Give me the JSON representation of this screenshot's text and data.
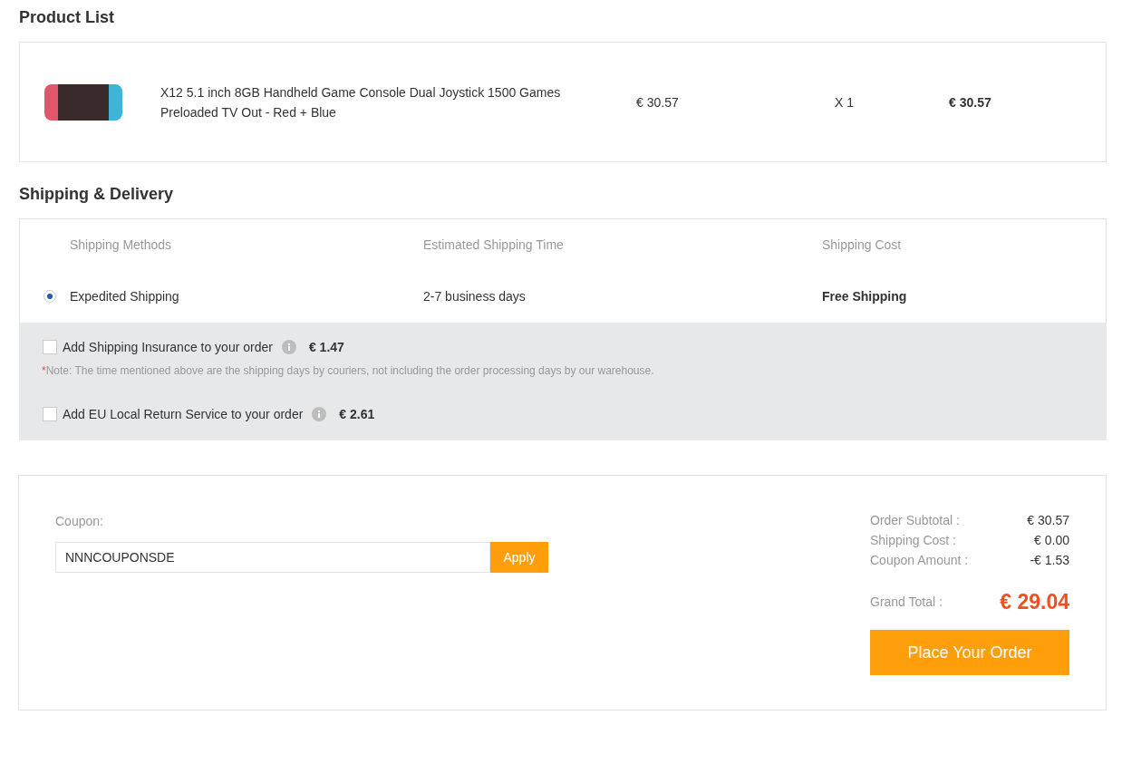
{
  "product_list": {
    "title": "Product List",
    "items": [
      {
        "name": "X12 5.1 inch 8GB Handheld Game Console Dual Joystick 1500 Games Preloaded TV Out - Red + Blue",
        "price": "€ 30.57",
        "quantity": "X 1",
        "total": "€ 30.57"
      }
    ]
  },
  "shipping": {
    "title": "Shipping & Delivery",
    "columns": [
      "Shipping Methods",
      "Estimated Shipping Time",
      "Shipping Cost"
    ],
    "methods": [
      {
        "name": "Expedited Shipping",
        "time": "2-7 business days",
        "cost": "Free Shipping",
        "selected": true
      }
    ],
    "options": [
      {
        "label": "Add Shipping Insurance to your order",
        "price": "€ 1.47",
        "checked": false
      },
      {
        "label": "Add EU Local Return Service to your order",
        "price": "€ 2.61",
        "checked": false
      }
    ],
    "note": {
      "mark": "*",
      "text": "Note: The time mentioned above are the shipping days by couriers, not including the order processing days by our warehouse."
    }
  },
  "summary": {
    "coupon_label": "Coupon:",
    "coupon_value": "NNNCOUPONSDE",
    "apply": "Apply",
    "lines": [
      {
        "label": "Order Subtotal :",
        "value": "€ 30.57"
      },
      {
        "label": "Shipping Cost :",
        "value": "€ 0.00"
      },
      {
        "label": "Coupon Amount :",
        "value": "-€ 1.53"
      }
    ],
    "grand_label": "Grand Total :",
    "grand_value": "€ 29.04",
    "place_order": "Place Your Order"
  }
}
